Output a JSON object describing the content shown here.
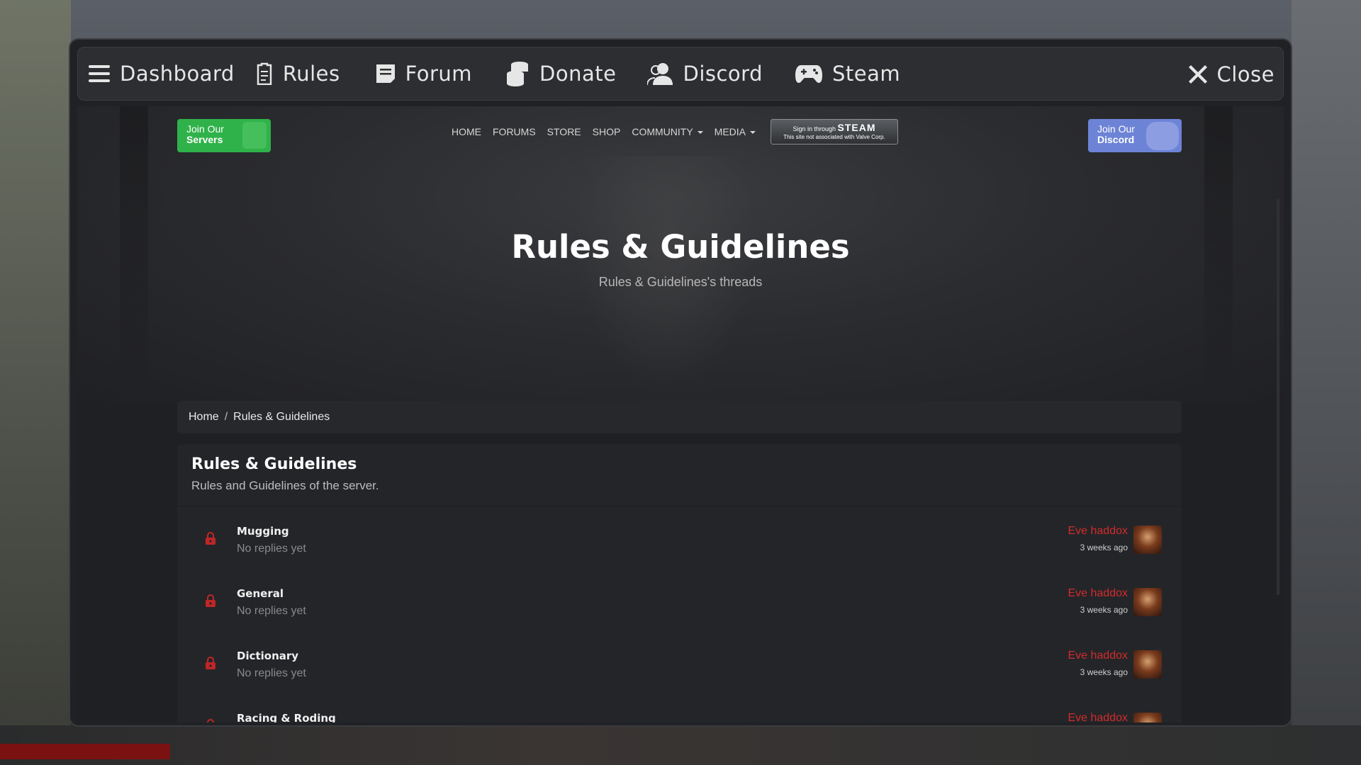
{
  "topbar": {
    "items": [
      {
        "label": "Dashboard",
        "icon": "menu-icon"
      },
      {
        "label": "Rules",
        "icon": "clipboard-icon"
      },
      {
        "label": "Forum",
        "icon": "document-icon"
      },
      {
        "label": "Donate",
        "icon": "coins-icon"
      },
      {
        "label": "Discord",
        "icon": "users-icon"
      },
      {
        "label": "Steam",
        "icon": "gamepad-icon"
      }
    ],
    "close_label": "Close"
  },
  "site": {
    "join_servers": {
      "line1": "Join Our",
      "line2": "Servers"
    },
    "join_discord": {
      "line1": "Join Our",
      "line2": "Discord"
    },
    "nav": {
      "home": "HOME",
      "forums": "FORUMS",
      "store": "STORE",
      "shop": "SHOP",
      "community": "COMMUNITY",
      "media": "MEDIA"
    },
    "steam": {
      "line1": "Sign in through",
      "brand": "STEAM",
      "line2": "This site not associated with Valve Corp."
    },
    "hero_title": "Rules & Guidelines",
    "hero_subtitle": "Rules & Guidelines's threads",
    "breadcrumb": {
      "home": "Home",
      "sep": "/",
      "current": "Rules & Guidelines"
    },
    "panel": {
      "title": "Rules & Guidelines",
      "description": "Rules and Guidelines of the server."
    },
    "threads": [
      {
        "title": "Mugging",
        "sub": "No replies yet",
        "author": "Eve haddox",
        "time": "3 weeks ago"
      },
      {
        "title": "General",
        "sub": "No replies yet",
        "author": "Eve haddox",
        "time": "3 weeks ago"
      },
      {
        "title": "Dictionary",
        "sub": "No replies yet",
        "author": "Eve haddox",
        "time": "3 weeks ago"
      },
      {
        "title": "Racing & Roding",
        "sub": "",
        "author": "Eve haddox",
        "time": ""
      }
    ]
  },
  "colors": {
    "accent_red": "#d22b2b",
    "servers_green": "#2fb24a",
    "discord_blue": "#6d83d6"
  }
}
